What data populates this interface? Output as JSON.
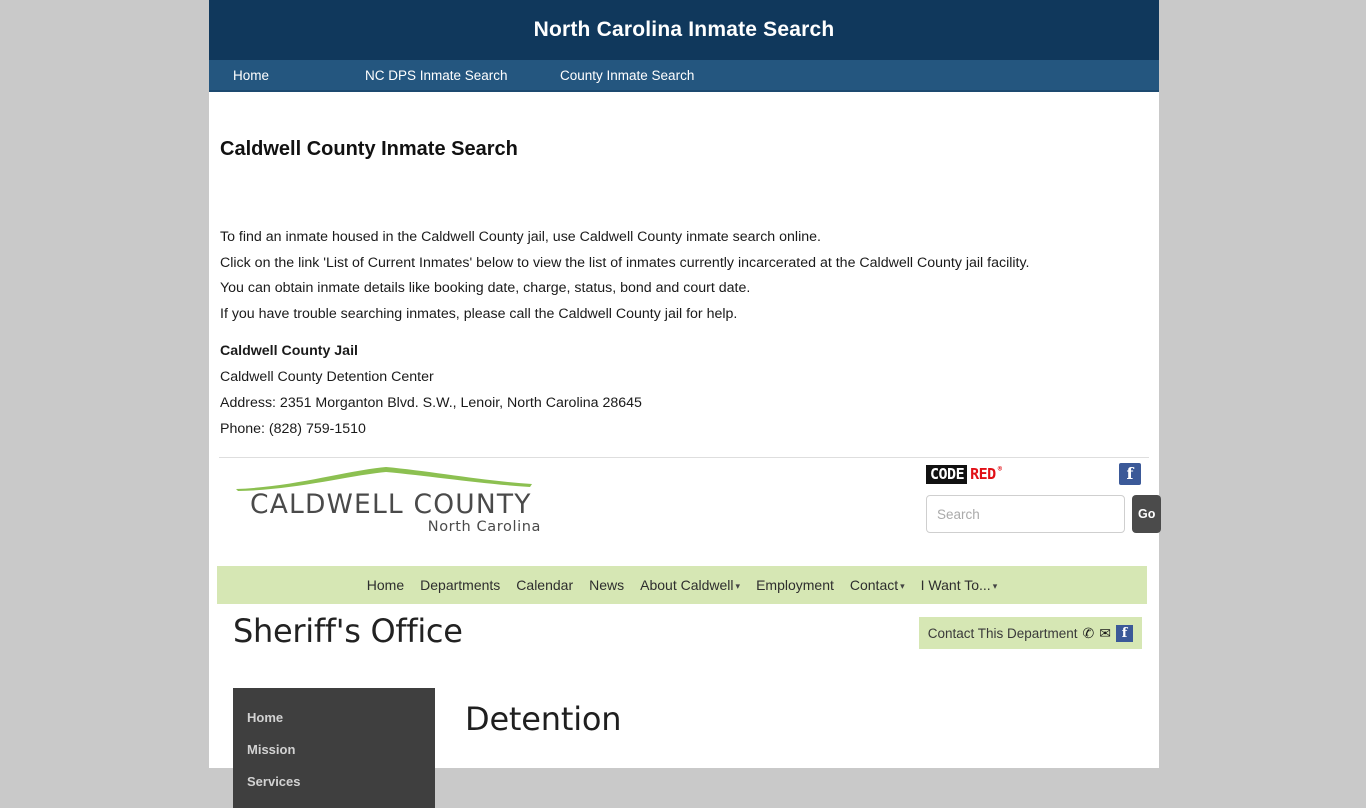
{
  "site": {
    "title": "North Carolina Inmate Search",
    "nav": [
      {
        "label": "Home",
        "name": "nav-home"
      },
      {
        "label": "NC DPS Inmate Search",
        "name": "nav-dps-inmate-search"
      },
      {
        "label": "County Inmate Search",
        "name": "nav-county-inmate-search"
      }
    ],
    "colors": {
      "header_bg": "#10385c",
      "nav_bg": "#24567f",
      "page_bg": "#c9c9c9"
    }
  },
  "article": {
    "heading": "Caldwell County Inmate Search",
    "paragraphs": [
      "To find an inmate housed in the Caldwell County jail, use Caldwell County inmate search online.",
      "Click on the link 'List of Current Inmates' below to view the list of inmates currently incarcerated at the Caldwell County jail facility.",
      "You can obtain inmate details like booking date, charge, status, bond and court date.",
      "If you have trouble searching inmates, please call the Caldwell County jail for help."
    ],
    "jail": {
      "name": "Caldwell County Jail",
      "facility": "Caldwell County Detention Center",
      "address": "Address: 2351 Morganton Blvd. S.W., Lenoir, North Carolina 28645",
      "phone": "Phone: (828) 759-1510"
    }
  },
  "embed": {
    "logo": {
      "main": "CALDWELL COUNTY",
      "sub": "North Carolina",
      "arc_color": "#8cc051"
    },
    "codered": {
      "code_text": "CODE",
      "red_text": "RED",
      "registered": "®",
      "red_color": "#e10f16"
    },
    "facebook_glyph": "f",
    "search": {
      "placeholder": "Search",
      "value": "",
      "button_label": "Go"
    },
    "county_nav": [
      {
        "label": "Home",
        "caret": false
      },
      {
        "label": "Departments",
        "caret": false
      },
      {
        "label": "Calendar",
        "caret": false
      },
      {
        "label": "News",
        "caret": false
      },
      {
        "label": "About Caldwell",
        "caret": true
      },
      {
        "label": "Employment",
        "caret": false
      },
      {
        "label": "Contact",
        "caret": true
      },
      {
        "label": "I Want To...",
        "caret": true
      }
    ],
    "nav_bg": "#d6e7b4",
    "department": {
      "title": "Sheriff's Office",
      "contact_label": "Contact This Department",
      "phone_glyph": "✆",
      "mail_glyph": "✉",
      "sidebar": [
        {
          "label": "Home"
        },
        {
          "label": "Mission"
        },
        {
          "label": "Services"
        }
      ],
      "content_heading": "Detention"
    }
  }
}
